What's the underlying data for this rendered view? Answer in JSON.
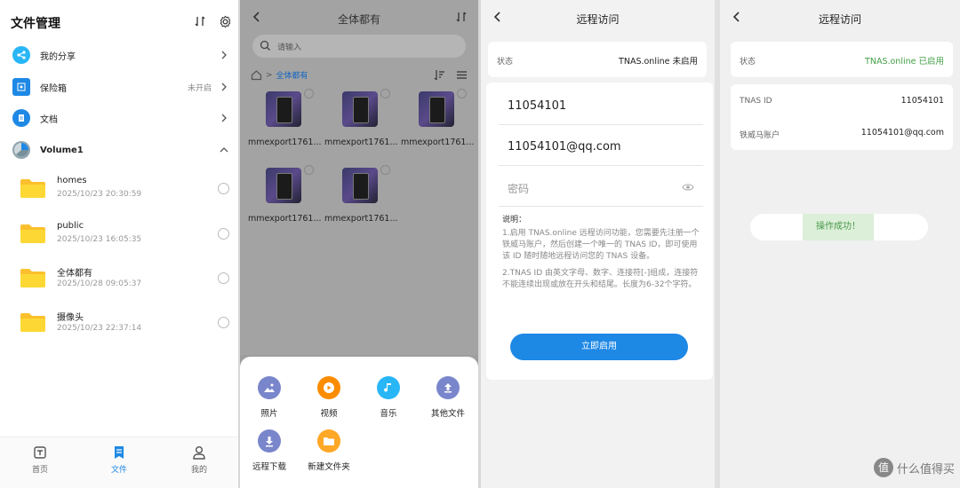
{
  "file_manager": {
    "title": "文件管理",
    "menu": [
      {
        "label": "我的分享",
        "icon": "share-icon",
        "color": "#29b6f6"
      },
      {
        "label": "保险箱",
        "icon": "safe-box-icon",
        "status": "未开启",
        "color": "#1e88e5"
      },
      {
        "label": "文档",
        "icon": "document-icon",
        "color": "#1e88e5"
      }
    ],
    "volume": {
      "label": "Volume1",
      "icon": "pie-chart-icon"
    },
    "folders": [
      {
        "name": "homes",
        "date": "2025/10/23 20:30:59"
      },
      {
        "name": "public",
        "date": "2025/10/23 16:05:35"
      },
      {
        "name": "全体都有",
        "date": "2025/10/28 09:05:37"
      },
      {
        "name": "摄像头",
        "date": "2025/10/23 22:37:14"
      }
    ],
    "tabs": [
      {
        "label": "首页",
        "icon": "home-icon"
      },
      {
        "label": "文件",
        "icon": "file-icon",
        "active": true
      },
      {
        "label": "我的",
        "icon": "user-icon"
      }
    ],
    "accent": "#1e88e5",
    "folder_color": "#fbc02d"
  },
  "folder_view": {
    "title": "全体都有",
    "search_placeholder": "请输入",
    "breadcrumb_sep": ">",
    "breadcrumb_current": "全体都有",
    "files": [
      "mmexport1761...",
      "mmexport1761...",
      "mmexport1761...",
      "mmexport1761...",
      "mmexport1761..."
    ],
    "actions": [
      {
        "label": "照片",
        "icon": "photo-icon",
        "color": "#7986cb"
      },
      {
        "label": "视频",
        "icon": "video-icon",
        "color": "#fb8c00"
      },
      {
        "label": "音乐",
        "icon": "music-icon",
        "color": "#29b6f6"
      },
      {
        "label": "其他文件",
        "icon": "upload-icon",
        "color": "#7986cb"
      },
      {
        "label": "远程下载",
        "icon": "download-icon",
        "color": "#7986cb"
      },
      {
        "label": "新建文件夹",
        "icon": "new-folder-icon",
        "color": "#ffa726"
      }
    ]
  },
  "remote_access_off": {
    "title": "远程访问",
    "status_label": "状态",
    "status_value": "TNAS.online 未启用",
    "id_value": "11054101",
    "account_value": "11054101@qq.com",
    "password_placeholder": "密码",
    "note_title": "说明：",
    "note_1": "1.启用 TNAS.online 远程访问功能，您需要先注册一个铁威马账户，然后创建一个唯一的 TNAS ID，即可使用该 ID 随时随地远程访问您的 TNAS 设备。",
    "note_2": "2.TNAS ID 由英文字母、数字、连接符[-]组成，连接符不能连续出现或放在开头和结尾。长度为6-32个字符。",
    "button": "立即启用"
  },
  "remote_access_on": {
    "title": "远程访问",
    "status_label": "状态",
    "status_value": "TNAS.online 已启用",
    "status_color": "#43a047",
    "id_label": "TNAS ID",
    "id_value": "11054101",
    "account_label": "铁威马账户",
    "account_value": "11054101@qq.com",
    "toast": "操作成功！"
  },
  "watermark": {
    "badge": "值",
    "text": "什么值得买"
  }
}
